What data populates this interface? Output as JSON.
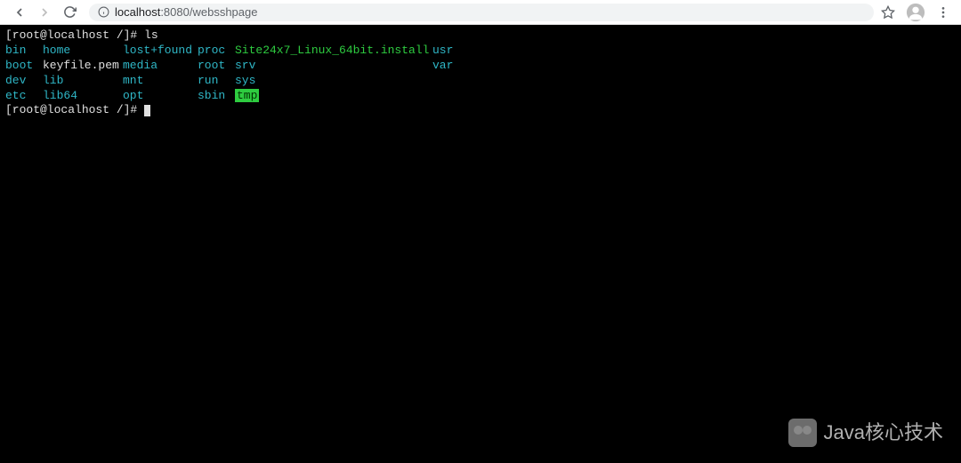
{
  "browser": {
    "url_host": "localhost",
    "url_port": ":8080",
    "url_path": "/websshpage"
  },
  "terminal": {
    "prompt1": "[root@localhost /]# ",
    "command1": "ls",
    "ls": {
      "row1": {
        "c1": "bin",
        "c2": "home",
        "c3": "lost+found",
        "c4": "proc",
        "c5": "Site24x7_Linux_64bit.install",
        "c6": "usr"
      },
      "row2": {
        "c1": "boot",
        "c2": "keyfile.pem",
        "c3": "media",
        "c4": "root",
        "c5": "srv",
        "c6": "var"
      },
      "row3": {
        "c1": "dev",
        "c2": "lib",
        "c3": "mnt",
        "c4": "run",
        "c5": "sys",
        "c6": ""
      },
      "row4": {
        "c1": "etc",
        "c2": "lib64",
        "c3": "opt",
        "c4": "sbin",
        "c5": "tmp",
        "c6": ""
      }
    },
    "prompt2": "[root@localhost /]# "
  },
  "watermark": {
    "text": "Java核心技术"
  }
}
